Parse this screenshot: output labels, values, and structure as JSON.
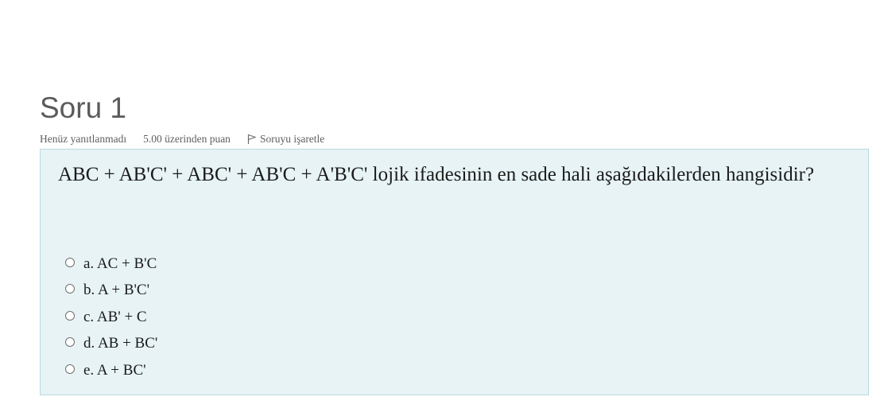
{
  "question": {
    "title": "Soru 1",
    "status": "Henüz yanıtlanmadı",
    "grade": "5.00 üzerinden puan",
    "flag_label": "Soruyu işaretle",
    "flag_icon": "flag-icon",
    "text": "ABC + AB'C' + ABC' + AB'C + A'B'C' lojik ifadesinin en sade hali aşağıdakilerden hangisidir?"
  },
  "answers": [
    {
      "label": "a. AC + B'C"
    },
    {
      "label": "b. A + B'C'"
    },
    {
      "label": "c. AB' + C"
    },
    {
      "label": "d. AB + BC'"
    },
    {
      "label": "e. A + BC'"
    }
  ],
  "colors": {
    "content_bg": "#e7f3f5",
    "content_border": "#b8dce2",
    "title": "#5b5b5b",
    "meta": "#5f5f5f"
  }
}
